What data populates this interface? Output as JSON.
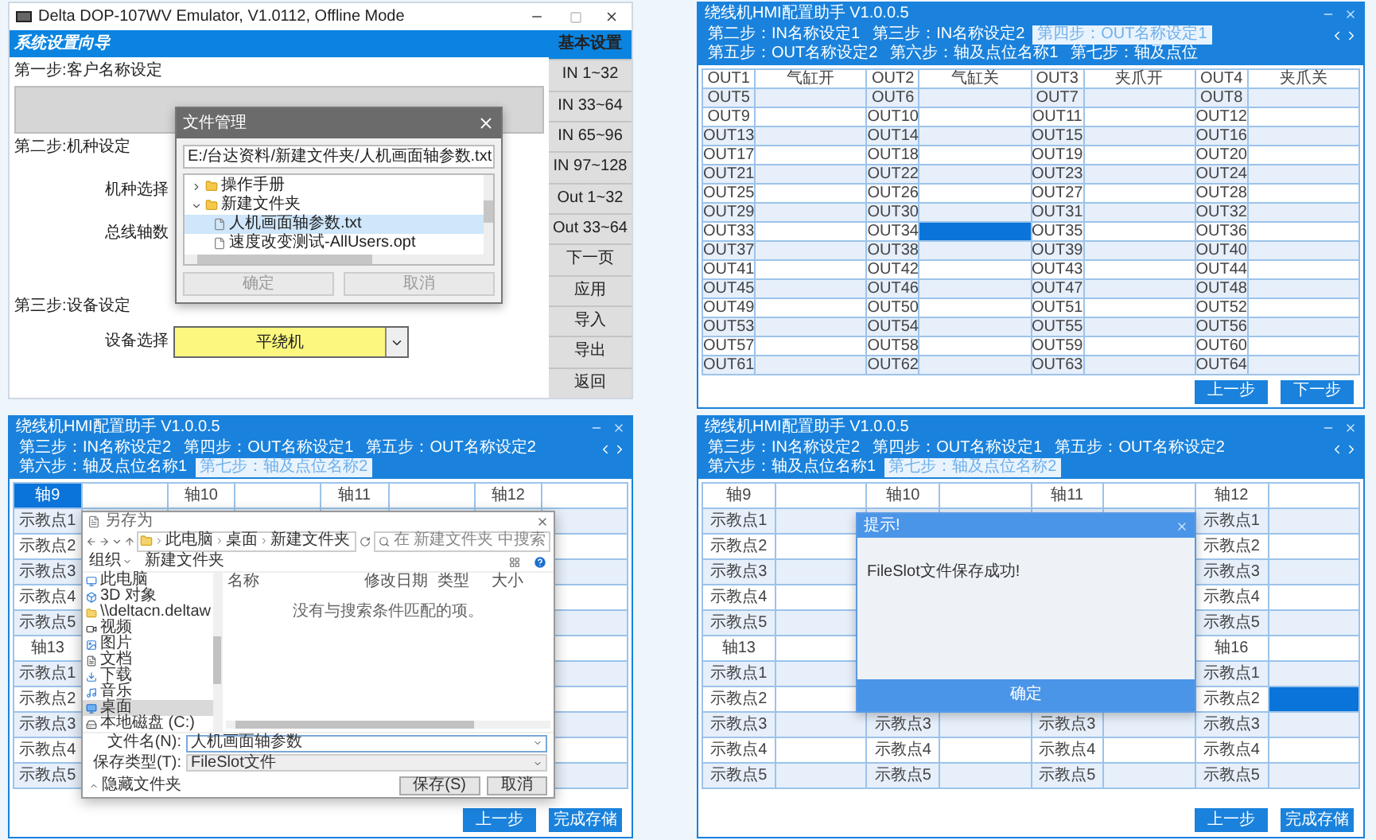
{
  "emulator": {
    "title": "Delta DOP-107WV Emulator, V1.0112, Offline Mode",
    "header": "系统设置向导",
    "menu": [
      {
        "label": "基本设置",
        "selected": true
      },
      {
        "label": "IN 1~32",
        "selected": false
      },
      {
        "label": "IN 33~64",
        "selected": false
      },
      {
        "label": "IN 65~96",
        "selected": false
      },
      {
        "label": "IN 97~128",
        "selected": false
      },
      {
        "label": "Out 1~32",
        "selected": false
      },
      {
        "label": "Out 33~64",
        "selected": false
      },
      {
        "label": "下一页",
        "selected": false
      },
      {
        "label": "应用",
        "selected": false
      },
      {
        "label": "导入",
        "selected": false
      },
      {
        "label": "导出",
        "selected": false
      },
      {
        "label": "返回",
        "selected": false
      }
    ],
    "step1": "第一步:客户名称设定",
    "step2": "第二步:机种设定",
    "model_label": "机种选择",
    "axes_label": "总线轴数",
    "step3": "第三步:设备设定",
    "device_label": "设备选择",
    "device_value": "平绕机",
    "file_dialog": {
      "title": "文件管理",
      "path": "E:/台达资料/新建文件夹/人机画面轴参数.txt",
      "tree": [
        {
          "label": "操作手册",
          "kind": "folder",
          "expanded": false,
          "selected": false
        },
        {
          "label": "新建文件夹",
          "kind": "folder",
          "expanded": true,
          "selected": false,
          "children": [
            {
              "label": "人机画面轴参数.txt",
              "kind": "file",
              "selected": true
            },
            {
              "label": "速度改变测试-AllUsers.opt",
              "kind": "file",
              "selected": false
            }
          ]
        }
      ],
      "buttons": [
        {
          "label": "确定",
          "disabled": true
        },
        {
          "label": "取消",
          "disabled": true
        }
      ]
    }
  },
  "config_windows": [
    {
      "title": "绕线机HMI配置助手 V1.0.0.5",
      "tabs": [
        {
          "label": "第二步：IN名称设定1",
          "selected": false
        },
        {
          "label": "第三步：IN名称设定2",
          "selected": false
        },
        {
          "label": "第四步：OUT名称设定1",
          "selected": true
        },
        {
          "label": "第五步：OUT名称设定2",
          "selected": false
        },
        {
          "label": "第六步：轴及点位名称1",
          "selected": false
        },
        {
          "label": "第七步：轴及点位",
          "selected": false
        }
      ],
      "table": {
        "rows": [
          {
            "cells": [
              {
                "text": "OUT1",
                "selected": false
              },
              {
                "text": "气缸开",
                "selected": false
              },
              {
                "text": "OUT2",
                "selected": false
              },
              {
                "text": "气缸关",
                "selected": false
              },
              {
                "text": "OUT3",
                "selected": false
              },
              {
                "text": "夹爪开",
                "selected": false
              },
              {
                "text": "OUT4",
                "selected": false
              },
              {
                "text": "夹爪关",
                "selected": false
              }
            ]
          },
          {
            "cells": [
              {
                "text": "OUT5",
                "selected": false
              },
              {
                "selected": false
              },
              {
                "text": "OUT6",
                "selected": false
              },
              {
                "selected": false
              },
              {
                "text": "OUT7",
                "selected": false
              },
              {
                "selected": false
              },
              {
                "text": "OUT8",
                "selected": false
              },
              {
                "selected": false
              }
            ]
          },
          {
            "cells": [
              {
                "text": "OUT9",
                "selected": false
              },
              {
                "selected": false
              },
              {
                "text": "OUT10",
                "selected": false
              },
              {
                "selected": false
              },
              {
                "text": "OUT11",
                "selected": false
              },
              {
                "selected": false
              },
              {
                "text": "OUT12",
                "selected": false
              },
              {
                "selected": false
              }
            ]
          },
          {
            "cells": [
              {
                "text": "OUT13",
                "selected": false
              },
              {
                "selected": false
              },
              {
                "text": "OUT14",
                "selected": false
              },
              {
                "selected": false
              },
              {
                "text": "OUT15",
                "selected": false
              },
              {
                "selected": false
              },
              {
                "text": "OUT16",
                "selected": false
              },
              {
                "selected": false
              }
            ]
          },
          {
            "cells": [
              {
                "text": "OUT17",
                "selected": false
              },
              {
                "selected": false
              },
              {
                "text": "OUT18",
                "selected": false
              },
              {
                "selected": false
              },
              {
                "text": "OUT19",
                "selected": false
              },
              {
                "selected": false
              },
              {
                "text": "OUT20",
                "selected": false
              },
              {
                "selected": false
              }
            ]
          },
          {
            "cells": [
              {
                "text": "OUT21",
                "selected": false
              },
              {
                "selected": false
              },
              {
                "text": "OUT22",
                "selected": false
              },
              {
                "selected": false
              },
              {
                "text": "OUT23",
                "selected": false
              },
              {
                "selected": false
              },
              {
                "text": "OUT24",
                "selected": false
              },
              {
                "selected": false
              }
            ]
          },
          {
            "cells": [
              {
                "text": "OUT25",
                "selected": false
              },
              {
                "selected": false
              },
              {
                "text": "OUT26",
                "selected": false
              },
              {
                "selected": false
              },
              {
                "text": "OUT27",
                "selected": false
              },
              {
                "selected": false
              },
              {
                "text": "OUT28",
                "selected": false
              },
              {
                "selected": false
              }
            ]
          },
          {
            "cells": [
              {
                "text": "OUT29",
                "selected": false
              },
              {
                "selected": false
              },
              {
                "text": "OUT30",
                "selected": false
              },
              {
                "selected": false
              },
              {
                "text": "OUT31",
                "selected": false
              },
              {
                "selected": false
              },
              {
                "text": "OUT32",
                "selected": false
              },
              {
                "selected": false
              }
            ]
          },
          {
            "cells": [
              {
                "text": "OUT33",
                "selected": false
              },
              {
                "selected": false
              },
              {
                "text": "OUT34",
                "selected": false
              },
              {
                "selected": true
              },
              {
                "text": "OUT35",
                "selected": false
              },
              {
                "selected": false
              },
              {
                "text": "OUT36",
                "selected": false
              },
              {
                "selected": false
              }
            ]
          },
          {
            "cells": [
              {
                "text": "OUT37",
                "selected": false
              },
              {
                "selected": false
              },
              {
                "text": "OUT38",
                "selected": false
              },
              {
                "selected": false
              },
              {
                "text": "OUT39",
                "selected": false
              },
              {
                "selected": false
              },
              {
                "text": "OUT40",
                "selected": false
              },
              {
                "selected": false
              }
            ]
          },
          {
            "cells": [
              {
                "text": "OUT41",
                "selected": false
              },
              {
                "selected": false
              },
              {
                "text": "OUT42",
                "selected": false
              },
              {
                "selected": false
              },
              {
                "text": "OUT43",
                "selected": false
              },
              {
                "selected": false
              },
              {
                "text": "OUT44",
                "selected": false
              },
              {
                "selected": false
              }
            ]
          },
          {
            "cells": [
              {
                "text": "OUT45",
                "selected": false
              },
              {
                "selected": false
              },
              {
                "text": "OUT46",
                "selected": false
              },
              {
                "selected": false
              },
              {
                "text": "OUT47",
                "selected": false
              },
              {
                "selected": false
              },
              {
                "text": "OUT48",
                "selected": false
              },
              {
                "selected": false
              }
            ]
          },
          {
            "cells": [
              {
                "text": "OUT49",
                "selected": false
              },
              {
                "selected": false
              },
              {
                "text": "OUT50",
                "selected": false
              },
              {
                "selected": false
              },
              {
                "text": "OUT51",
                "selected": false
              },
              {
                "selected": false
              },
              {
                "text": "OUT52",
                "selected": false
              },
              {
                "selected": false
              }
            ]
          },
          {
            "cells": [
              {
                "text": "OUT53",
                "selected": false
              },
              {
                "selected": false
              },
              {
                "text": "OUT54",
                "selected": false
              },
              {
                "selected": false
              },
              {
                "text": "OUT55",
                "selected": false
              },
              {
                "selected": false
              },
              {
                "text": "OUT56",
                "selected": false
              },
              {
                "selected": false
              }
            ]
          },
          {
            "cells": [
              {
                "text": "OUT57",
                "selected": false
              },
              {
                "selected": false
              },
              {
                "text": "OUT58",
                "selected": false
              },
              {
                "selected": false
              },
              {
                "text": "OUT59",
                "selected": false
              },
              {
                "selected": false
              },
              {
                "text": "OUT60",
                "selected": false
              },
              {
                "selected": false
              }
            ]
          },
          {
            "cells": [
              {
                "text": "OUT61",
                "selected": false
              },
              {
                "selected": false
              },
              {
                "text": "OUT62",
                "selected": false
              },
              {
                "selected": false
              },
              {
                "text": "OUT63",
                "selected": false
              },
              {
                "selected": false
              },
              {
                "text": "OUT64",
                "selected": false
              },
              {
                "selected": false
              }
            ]
          }
        ]
      },
      "buttons": [
        "上一步",
        "下一步"
      ]
    },
    {
      "title": "绕线机HMI配置助手 V1.0.0.5",
      "tabs": [
        {
          "label": "第三步：IN名称设定2",
          "selected": false
        },
        {
          "label": "第四步：OUT名称设定1",
          "selected": false
        },
        {
          "label": "第五步：OUT名称设定2",
          "selected": false
        },
        {
          "label": "第六步：轴及点位名称1",
          "selected": false
        },
        {
          "label": "第七步：轴及点位名称2",
          "selected": true
        }
      ],
      "table": {
        "rows": [
          {
            "cells": [
              {
                "text": "轴9",
                "selected": true
              },
              {
                "selected": false
              },
              {
                "text": "轴10",
                "selected": false
              },
              {
                "selected": false
              },
              {
                "text": "轴11",
                "selected": false
              },
              {
                "selected": false
              },
              {
                "text": "轴12",
                "selected": false
              },
              {
                "selected": false
              }
            ]
          },
          {
            "cells": [
              {
                "text": "示教点1",
                "selected": false
              },
              {},
              {},
              {},
              {},
              {},
              {},
              {
                "selected": false
              }
            ]
          },
          {
            "cells": [
              {
                "text": "示教点2",
                "selected": false
              },
              {},
              {},
              {},
              {},
              {},
              {},
              {
                "selected": false
              }
            ]
          },
          {
            "cells": [
              {
                "text": "示教点3",
                "selected": false
              },
              {},
              {},
              {},
              {},
              {},
              {},
              {
                "selected": false
              }
            ]
          },
          {
            "cells": [
              {
                "text": "示教点4",
                "selected": false
              },
              {},
              {},
              {},
              {},
              {},
              {},
              {
                "selected": false
              }
            ]
          },
          {
            "cells": [
              {
                "text": "示教点5",
                "selected": false
              },
              {},
              {},
              {},
              {},
              {},
              {},
              {
                "selected": false
              }
            ]
          },
          {
            "cells": [
              {
                "text": "轴13",
                "selected": false
              },
              {},
              {},
              {},
              {},
              {},
              {},
              {
                "selected": false
              }
            ]
          },
          {
            "cells": [
              {
                "text": "示教点1",
                "selected": false
              },
              {},
              {},
              {},
              {},
              {},
              {},
              {
                "selected": false
              }
            ]
          },
          {
            "cells": [
              {
                "text": "示教点2",
                "selected": false
              },
              {},
              {},
              {},
              {},
              {},
              {},
              {
                "selected": false
              }
            ]
          },
          {
            "cells": [
              {
                "text": "示教点3",
                "selected": false
              },
              {},
              {},
              {},
              {},
              {},
              {},
              {
                "selected": false
              }
            ]
          },
          {
            "cells": [
              {
                "text": "示教点4",
                "selected": false
              },
              {},
              {},
              {},
              {},
              {},
              {},
              {
                "selected": false
              }
            ]
          },
          {
            "cells": [
              {
                "text": "示教点5",
                "selected": false
              },
              {},
              {},
              {},
              {},
              {},
              {},
              {
                "selected": false
              }
            ]
          }
        ]
      },
      "dialog": {
        "kind": "save_as",
        "title": "另存为",
        "path": [
          "此电脑",
          "桌面",
          "新建文件夹"
        ],
        "search_placeholder": "在 新建文件夹 中搜索",
        "organize": "组织",
        "new_folder": "新建文件夹",
        "nav": [
          {
            "label": "此电脑",
            "kind": "computer",
            "selected": false
          },
          {
            "label": "3D 对象",
            "kind": "cube",
            "selected": false
          },
          {
            "label": "\\\\deltacn.deltaw",
            "kind": "folder",
            "selected": false
          },
          {
            "label": "视频",
            "kind": "video",
            "selected": false
          },
          {
            "label": "图片",
            "kind": "image",
            "selected": false
          },
          {
            "label": "文档",
            "kind": "document",
            "selected": false
          },
          {
            "label": "下载",
            "kind": "download",
            "selected": false
          },
          {
            "label": "音乐",
            "kind": "music",
            "selected": false
          },
          {
            "label": "桌面",
            "kind": "desktop",
            "selected": true
          },
          {
            "label": "本地磁盘 (C:)",
            "kind": "drive",
            "selected": false
          }
        ],
        "columns": [
          "名称",
          "修改日期",
          "类型",
          "大小"
        ],
        "empty_message": "没有与搜索条件匹配的项。",
        "filename_label": "文件名(N):",
        "filename": "人机画面轴参数",
        "type_label": "保存类型(T):",
        "type": "FileSlot文件",
        "hide_folders": "隐藏文件夹",
        "buttons": [
          "保存(S)",
          "取消"
        ]
      },
      "buttons": [
        "上一步",
        "完成存储"
      ]
    },
    {
      "title": "绕线机HMI配置助手 V1.0.0.5",
      "tabs": [
        {
          "label": "第三步：IN名称设定2",
          "selected": false
        },
        {
          "label": "第四步：OUT名称设定1",
          "selected": false
        },
        {
          "label": "第五步：OUT名称设定2",
          "selected": false
        },
        {
          "label": "第六步：轴及点位名称1",
          "selected": false
        },
        {
          "label": "第七步：轴及点位名称2",
          "selected": true
        }
      ],
      "table": {
        "rows": [
          {
            "cells": [
              {
                "text": "轴9",
                "selected": false
              },
              {
                "selected": false
              },
              {
                "text": "轴10",
                "selected": false
              },
              {
                "selected": false
              },
              {
                "text": "轴11",
                "selected": false
              },
              {
                "selected": false
              },
              {
                "text": "轴12",
                "selected": false
              },
              {
                "selected": false
              }
            ]
          },
          {
            "cells": [
              {
                "text": "示教点1",
                "selected": false
              },
              {
                "selected": false
              },
              {},
              {},
              {},
              {},
              {
                "text": "示教点1",
                "selected": false
              },
              {
                "selected": false
              }
            ]
          },
          {
            "cells": [
              {
                "text": "示教点2",
                "selected": false
              },
              {
                "selected": false
              },
              {},
              {},
              {},
              {},
              {
                "text": "示教点2",
                "selected": false
              },
              {
                "selected": false
              }
            ]
          },
          {
            "cells": [
              {
                "text": "示教点3",
                "selected": false
              },
              {
                "selected": false
              },
              {},
              {},
              {},
              {},
              {
                "text": "示教点3",
                "selected": false
              },
              {
                "selected": false
              }
            ]
          },
          {
            "cells": [
              {
                "text": "示教点4",
                "selected": false
              },
              {
                "selected": false
              },
              {},
              {},
              {},
              {},
              {
                "text": "示教点4",
                "selected": false
              },
              {
                "selected": false
              }
            ]
          },
          {
            "cells": [
              {
                "text": "示教点5",
                "selected": false
              },
              {
                "selected": false
              },
              {},
              {},
              {},
              {},
              {
                "text": "示教点5",
                "selected": false
              },
              {
                "selected": false
              }
            ]
          },
          {
            "cells": [
              {
                "text": "轴13",
                "selected": false
              },
              {
                "selected": false
              },
              {},
              {},
              {},
              {},
              {
                "text": "轴16",
                "selected": false
              },
              {
                "selected": false
              }
            ]
          },
          {
            "cells": [
              {
                "text": "示教点1",
                "selected": false
              },
              {
                "selected": false
              },
              {},
              {},
              {},
              {},
              {
                "text": "示教点1",
                "selected": false
              },
              {
                "selected": false
              }
            ]
          },
          {
            "cells": [
              {
                "text": "示教点2",
                "selected": false
              },
              {
                "selected": false
              },
              {},
              {},
              {},
              {},
              {
                "text": "示教点2",
                "selected": false
              },
              {
                "selected": true
              }
            ]
          },
          {
            "cells": [
              {
                "text": "示教点3",
                "selected": false
              },
              {
                "selected": false
              },
              {
                "text": "示教点3",
                "selected": false
              },
              {
                "selected": false
              },
              {
                "text": "示教点3",
                "selected": false
              },
              {
                "selected": false
              },
              {
                "text": "示教点3",
                "selected": false
              },
              {
                "selected": false
              }
            ]
          },
          {
            "cells": [
              {
                "text": "示教点4",
                "selected": false
              },
              {
                "selected": false
              },
              {
                "text": "示教点4",
                "selected": false
              },
              {
                "selected": false
              },
              {
                "text": "示教点4",
                "selected": false
              },
              {
                "selected": false
              },
              {
                "text": "示教点4",
                "selected": false
              },
              {
                "selected": false
              }
            ]
          },
          {
            "cells": [
              {
                "text": "示教点5",
                "selected": false
              },
              {
                "selected": false
              },
              {
                "text": "示教点5",
                "selected": false
              },
              {
                "selected": false
              },
              {
                "text": "示教点5",
                "selected": false
              },
              {
                "selected": false
              },
              {
                "text": "示教点5",
                "selected": false
              },
              {
                "selected": false
              }
            ]
          }
        ]
      },
      "dialog": {
        "kind": "message",
        "title": "提示!",
        "message": "FileSlot文件保存成功!",
        "button": "确定"
      },
      "buttons": [
        "上一步",
        "完成存储"
      ]
    }
  ]
}
